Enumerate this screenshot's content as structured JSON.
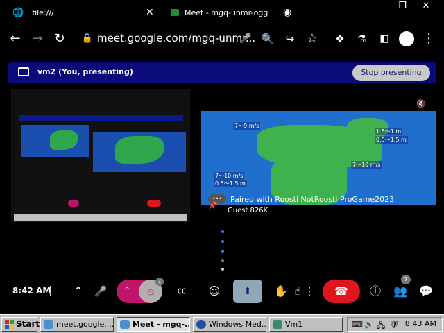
{
  "browser": {
    "tabs": [
      {
        "title": "file:///",
        "icon": "globe-icon"
      },
      {
        "title": "Meet - mgq-unmr-ogg",
        "icon": "meet-icon"
      }
    ],
    "url": "meet.google.com/mgq-unmr..."
  },
  "banner": {
    "text": "vm2 (You, presenting)",
    "stop_label": "Stop presenting"
  },
  "remote": {
    "paired_text": "Paired with Roosti NotRoosti ProGame2023",
    "guest_name": "Guest 826K",
    "map_labels": [
      "7～9 m/s",
      "1.5～1 m",
      "7～10 m/s",
      "0.5～1.5 m",
      "7～10 m/s",
      "0.5～1.5 m"
    ]
  },
  "controls": {
    "time": "8:42 AM",
    "camera_badge": "1",
    "people_badge": "7"
  },
  "taskbar": {
    "start_label": "Start",
    "tasks": [
      {
        "label": "meet.google....",
        "active": false
      },
      {
        "label": "Meet - mgq-...",
        "active": true
      },
      {
        "label": "Windows Med...",
        "active": false
      },
      {
        "label": "Vm1",
        "active": false
      }
    ],
    "time": "8:43 AM"
  },
  "colors": {
    "banner_bg": "#0a0a7a",
    "accent_pink": "#c0136a",
    "end_call_red": "#e0161e",
    "map_sea": "#1f6fcf",
    "map_land": "#3fb24f"
  }
}
